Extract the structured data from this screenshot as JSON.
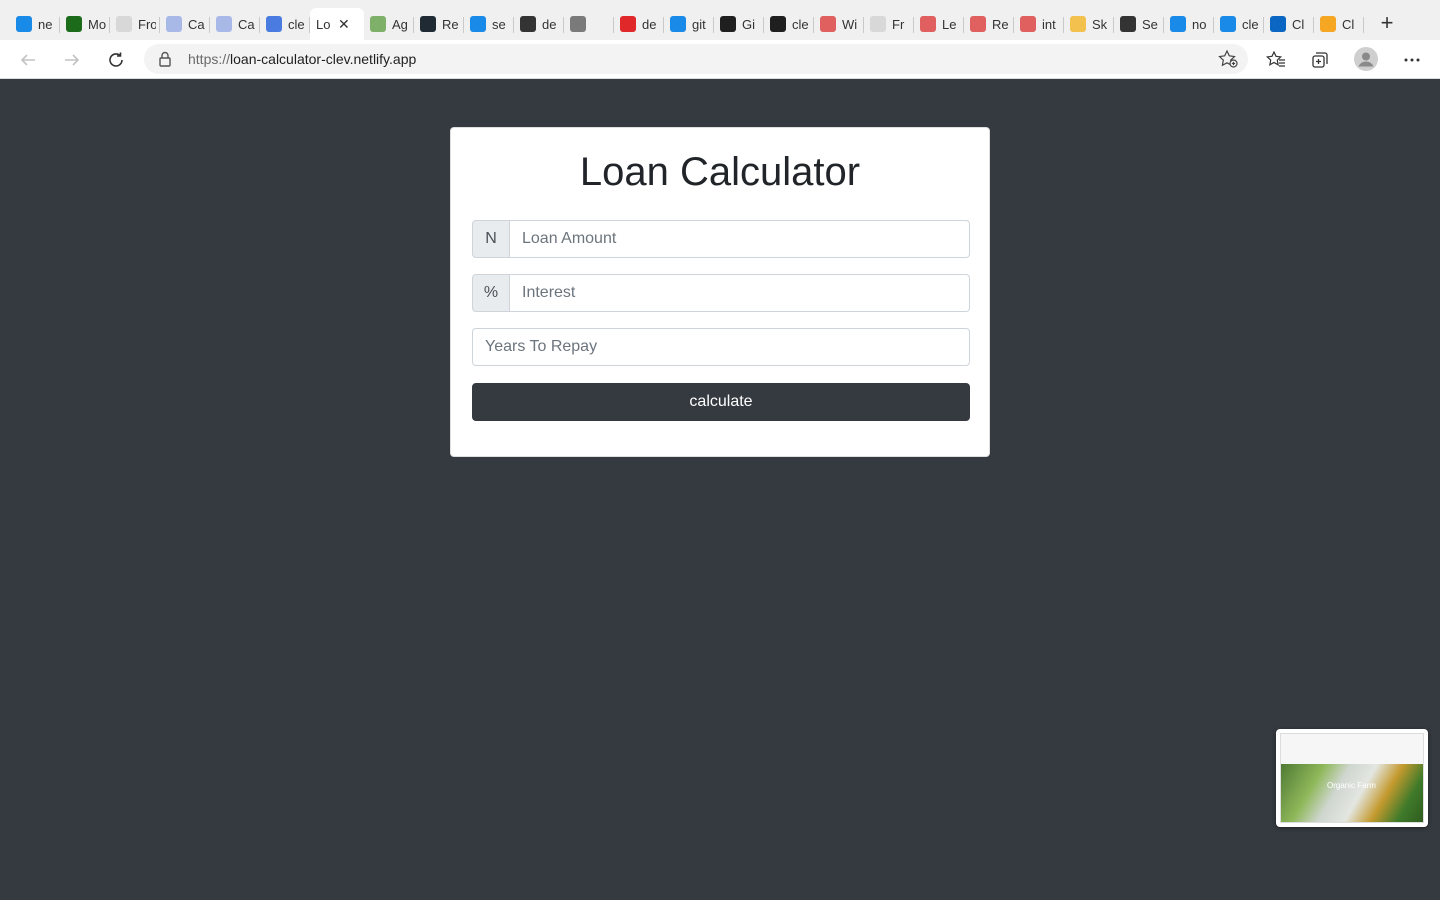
{
  "browser": {
    "tabs": [
      {
        "title": "ne",
        "icon": "bing-icon",
        "color": "#1a8ae8"
      },
      {
        "title": "Mo",
        "icon": "n-logo-icon",
        "color": "#1b6b1b"
      },
      {
        "title": "Fro",
        "icon": "gmail-icon",
        "color": "#d8d8d8"
      },
      {
        "title": "Ca",
        "icon": "docs-icon",
        "color": "#a8b9e8"
      },
      {
        "title": "Ca",
        "icon": "docs-icon",
        "color": "#a8b9e8"
      },
      {
        "title": "cle",
        "icon": "docs-icon",
        "color": "#4a7be0"
      },
      {
        "title": "Lo",
        "icon": "",
        "color": "",
        "active": true
      },
      {
        "title": "Ag",
        "icon": "bowl-icon",
        "color": "#7fb069"
      },
      {
        "title": "Re",
        "icon": "react-icon",
        "color": "#1f2a35"
      },
      {
        "title": "se",
        "icon": "bing-icon",
        "color": "#1a8ae8"
      },
      {
        "title": "de",
        "icon": "lock-icon",
        "color": "#333333"
      },
      {
        "title": "",
        "icon": "chat-icon",
        "color": "#7a7a7a"
      },
      {
        "title": "de",
        "icon": "heart-icon",
        "color": "#e0282b"
      },
      {
        "title": "git",
        "icon": "bing-icon",
        "color": "#1a8ae8"
      },
      {
        "title": "Gi",
        "icon": "github-icon",
        "color": "#1f1f1f"
      },
      {
        "title": "cle",
        "icon": "github-icon",
        "color": "#1f1f1f"
      },
      {
        "title": "Wi",
        "icon": "youtube-icon",
        "color": "#e06060"
      },
      {
        "title": "Fr",
        "icon": "gmail-icon",
        "color": "#d8d8d8"
      },
      {
        "title": "Le",
        "icon": "youtube-icon",
        "color": "#e06060"
      },
      {
        "title": "Re",
        "icon": "youtube-icon",
        "color": "#e06060"
      },
      {
        "title": "int",
        "icon": "youtube-icon",
        "color": "#e06060"
      },
      {
        "title": "Sk",
        "icon": "sketch-icon",
        "color": "#f2c14e"
      },
      {
        "title": "Se",
        "icon": "gear-icon",
        "color": "#333333"
      },
      {
        "title": "no",
        "icon": "bing-icon",
        "color": "#1a8ae8"
      },
      {
        "title": "cle",
        "icon": "bing-icon",
        "color": "#1a8ae8"
      },
      {
        "title": "Cl",
        "icon": "linkedin-icon",
        "color": "#0a66c2"
      },
      {
        "title": "Cl",
        "icon": "orange-icon",
        "color": "#f5a623"
      }
    ],
    "url_scheme": "https://",
    "url_host": "loan-calculator-clev.netlify.app"
  },
  "app": {
    "title": "Loan Calculator",
    "amount_prefix": "N",
    "amount_placeholder": "Loan Amount",
    "interest_prefix": "%",
    "interest_placeholder": "Interest",
    "years_placeholder": "Years To Repay",
    "calculate_label": "calculate"
  },
  "thumbnail": {
    "title": "Organic Farm"
  }
}
